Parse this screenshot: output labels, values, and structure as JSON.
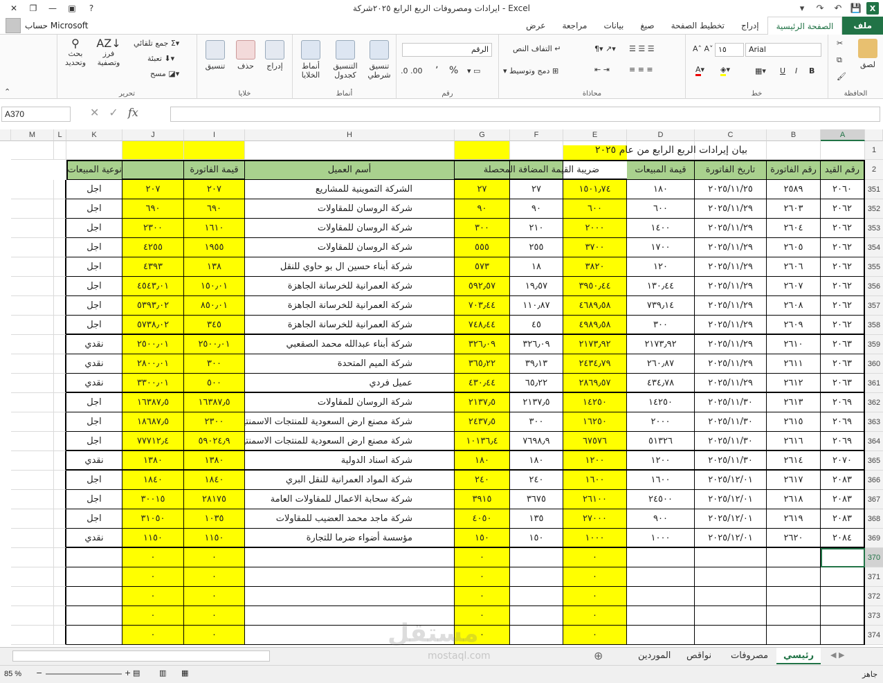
{
  "window": {
    "title": "ايرادات ومصروفات الربع الرابع  ٢٠٢٥شركة - Excel",
    "help": "?",
    "account_name": "حساب Microsoft"
  },
  "ribbon_tabs": [
    "ملف",
    "الصفحة الرئيسية",
    "إدراج",
    "تخطيط الصفحة",
    "صيغ",
    "بيانات",
    "مراجعة",
    "عرض"
  ],
  "ribbon": {
    "clipboard": {
      "label": "الحافظة",
      "paste": "لصق"
    },
    "font": {
      "label": "خط",
      "name": "Arial",
      "size": "١٥",
      "bold": "B",
      "italic": "I",
      "underline": "U"
    },
    "alignment": {
      "label": "محاذاة",
      "wrap": "التفاف النص",
      "merge": "دمج وتوسيط"
    },
    "number": {
      "label": "رقم",
      "format": "الرقم",
      "percent": "%",
      "comma": "٬"
    },
    "styles": {
      "label": "أنماط",
      "conditional": "تنسيق شرطي",
      "table": "التنسيق كجدول",
      "cell": "أنماط الخلايا"
    },
    "cells": {
      "label": "خلايا",
      "insert": "إدراج",
      "delete": "حذف",
      "format": "تنسيق"
    },
    "editing": {
      "label": "تحرير",
      "autosum": "جمع تلقائي",
      "fill": "تعبئة",
      "clear": "مسح",
      "sort": "فرز وتصفية",
      "find": "بحث وتحديد"
    }
  },
  "name_box": "A370",
  "fx": "fx",
  "columns": [
    "A",
    "B",
    "C",
    "D",
    "E",
    "F",
    "G",
    "H",
    "I",
    "J",
    "K",
    "L",
    "M"
  ],
  "title_row": {
    "row": "1",
    "text": "بيان إيرادات الربع الرابع من عام ٢٠٢٥"
  },
  "header_row": {
    "row": "2",
    "cells": [
      "رقم القيد",
      "رقم الفاتورة",
      "تاريخ الفاتورة",
      "قيمة المبيعات",
      "ضريبة القيمة المضافة المحصلة",
      "",
      "",
      "أسم العميل",
      "قيمة الفاتورة",
      "",
      "نوعية المبيعات"
    ]
  },
  "rows": [
    {
      "n": "351",
      "a": "٢٠٦٠",
      "b": "٢٥٨٩",
      "c": "٢٠٢٥/١١/٢٥",
      "d": "١٨٠",
      "e": "١٥٠١٫٧٤",
      "f": "٢٧",
      "g": "٢٧",
      "h": "الشركة التموينية للمشاريع",
      "i": "٢٠٧",
      "j": "٢٠٧",
      "k": "اجل"
    },
    {
      "n": "352",
      "a": "٢٠٦٢",
      "b": "٢٦٠٣",
      "c": "٢٠٢٥/١١/٢٩",
      "d": "٦٠٠",
      "e": "٦٠٠",
      "f": "٩٠",
      "g": "٩٠",
      "h": "شركة الروسان للمقاولات",
      "i": "٦٩٠",
      "j": "٦٩٠",
      "k": "اجل"
    },
    {
      "n": "353",
      "a": "٢٠٦٢",
      "b": "٢٦٠٤",
      "c": "٢٠٢٥/١١/٢٩",
      "d": "١٤٠٠",
      "e": "٢٠٠٠",
      "f": "٢١٠",
      "g": "٣٠٠",
      "h": "شركة الروسان للمقاولات",
      "i": "١٦١٠",
      "j": "٢٣٠٠",
      "k": "اجل"
    },
    {
      "n": "354",
      "a": "٢٠٦٢",
      "b": "٢٦٠٥",
      "c": "٢٠٢٥/١١/٢٩",
      "d": "١٧٠٠",
      "e": "٣٧٠٠",
      "f": "٢٥٥",
      "g": "٥٥٥",
      "h": "شركة الروسان للمقاولات",
      "i": "١٩٥٥",
      "j": "٤٢٥٥",
      "k": "اجل"
    },
    {
      "n": "355",
      "a": "٢٠٦٢",
      "b": "٢٦٠٦",
      "c": "٢٠٢٥/١١/٢٩",
      "d": "١٢٠",
      "e": "٣٨٢٠",
      "f": "١٨",
      "g": "٥٧٣",
      "h": "شركة أبناء حسين ال بو حاوي للنقل",
      "i": "١٣٨",
      "j": "٤٣٩٣",
      "k": "اجل"
    },
    {
      "n": "356",
      "a": "٢٠٦٢",
      "b": "٢٦٠٧",
      "c": "٢٠٢٥/١١/٢٩",
      "d": "١٣٠٫٤٤",
      "e": "٣٩٥٠٫٤٤",
      "f": "١٩٫٥٧",
      "g": "٥٩٢٫٥٧",
      "h": "شركة العمرانية للخرسانة الجاهزة",
      "i": "١٥٠٫٠١",
      "j": "٤٥٤٣٫٠١",
      "k": "اجل"
    },
    {
      "n": "357",
      "a": "٢٠٦٢",
      "b": "٢٦٠٨",
      "c": "٢٠٢٥/١١/٢٩",
      "d": "٧٣٩٫١٤",
      "e": "٤٦٨٩٫٥٨",
      "f": "١١٠٫٨٧",
      "g": "٧٠٣٫٤٤",
      "h": "شركة العمرانية للخرسانة الجاهزة",
      "i": "٨٥٠٫٠١",
      "j": "٥٣٩٣٫٠٢",
      "k": "اجل"
    },
    {
      "n": "358",
      "a": "٢٠٦٢",
      "b": "٢٦٠٩",
      "c": "٢٠٢٥/١١/٢٩",
      "d": "٣٠٠",
      "e": "٤٩٨٩٫٥٨",
      "f": "٤٥",
      "g": "٧٤٨٫٤٤",
      "h": "شركة العمرانية للخرسانة الجاهزة",
      "i": "٣٤٥",
      "j": "٥٧٣٨٫٠٢",
      "k": "اجل"
    },
    {
      "n": "359",
      "a": "٢٠٦٣",
      "b": "٢٦١٠",
      "c": "٢٠٢٥/١١/٢٩",
      "d": "٢١٧٣٫٩٢",
      "e": "٢١٧٣٫٩٢",
      "f": "٣٢٦٫٠٩",
      "g": "٣٢٦٫٠٩",
      "h": "شركة أبناء عبدالله محمد الصقعبي",
      "i": "٢٥٠٠٫٠١",
      "j": "٢٥٠٠٫٠١",
      "k": "نقدي"
    },
    {
      "n": "360",
      "a": "٢٠٦٣",
      "b": "٢٦١١",
      "c": "٢٠٢٥/١١/٢٩",
      "d": "٢٦٠٫٨٧",
      "e": "٢٤٣٤٫٧٩",
      "f": "٣٩٫١٣",
      "g": "٣٦٥٫٢٢",
      "h": "شركة الميم المتحدة",
      "i": "٣٠٠",
      "j": "٢٨٠٠٫٠١",
      "k": "نقدي"
    },
    {
      "n": "361",
      "a": "٢٠٦٣",
      "b": "٢٦١٢",
      "c": "٢٠٢٥/١١/٢٩",
      "d": "٤٣٤٫٧٨",
      "e": "٢٨٦٩٫٥٧",
      "f": "٦٥٫٢٢",
      "g": "٤٣٠٫٤٤",
      "h": "عميل فردي",
      "i": "٥٠٠",
      "j": "٣٣٠٠٫٠١",
      "k": "نقدي"
    },
    {
      "n": "362",
      "a": "٢٠٦٩",
      "b": "٢٦١٣",
      "c": "٢٠٢٥/١١/٣٠",
      "d": "١٤٢٥٠",
      "e": "١٤٢٥٠",
      "f": "٢١٣٧٫٥",
      "g": "٢١٣٧٫٥",
      "h": "شركة الروسان للمقاولات",
      "i": "١٦٣٨٧٫٥",
      "j": "١٦٣٨٧٫٥",
      "k": "اجل"
    },
    {
      "n": "363",
      "a": "٢٠٦٩",
      "b": "٢٦١٥",
      "c": "٢٠٢٥/١١/٣٠",
      "d": "٢٠٠٠",
      "e": "١٦٢٥٠",
      "f": "٣٠٠",
      "g": "٢٤٣٧٫٥",
      "h": "شركة مصنع ارض السعودية للمنتجات الاسمنتية",
      "i": "٢٣٠٠",
      "j": "١٨٦٨٧٫٥",
      "k": "اجل"
    },
    {
      "n": "364",
      "a": "٢٠٦٩",
      "b": "٢٦١٦",
      "c": "٢٠٢٥/١١/٣٠",
      "d": "٥١٣٢٦",
      "e": "٦٧٥٧٦",
      "f": "٧٦٩٨٫٩",
      "g": "١٠١٣٦٫٤",
      "h": "شركة مصنع ارض السعودية للمنتجات الاسمنتية",
      "i": "٥٩٠٢٤٫٩",
      "j": "٧٧٧١٢٫٤",
      "k": "اجل"
    },
    {
      "n": "365",
      "a": "٢٠٧٠",
      "b": "٢٦١٤",
      "c": "٢٠٢٥/١١/٣٠",
      "d": "١٢٠٠",
      "e": "١٢٠٠",
      "f": "١٨٠",
      "g": "١٨٠",
      "h": "شركة اسناد الدولية",
      "i": "١٣٨٠",
      "j": "١٣٨٠",
      "k": "نقدي"
    },
    {
      "n": "366",
      "a": "٢٠٨٣",
      "b": "٢٦١٧",
      "c": "٢٠٢٥/١٢/٠١",
      "d": "١٦٠٠",
      "e": "١٦٠٠",
      "f": "٢٤٠",
      "g": "٢٤٠",
      "h": "شركة المواد العمرانية للنقل البري",
      "i": "١٨٤٠",
      "j": "١٨٤٠",
      "k": "اجل"
    },
    {
      "n": "367",
      "a": "٢٠٨٣",
      "b": "٢٦١٨",
      "c": "٢٠٢٥/١٢/٠١",
      "d": "٢٤٥٠٠",
      "e": "٢٦١٠٠",
      "f": "٣٦٧٥",
      "g": "٣٩١٥",
      "h": "شركة سحابة الاعمال للمقاولات العامة",
      "i": "٢٨١٧٥",
      "j": "٣٠٠١٥",
      "k": "اجل"
    },
    {
      "n": "368",
      "a": "٢٠٨٣",
      "b": "٢٦١٩",
      "c": "٢٠٢٥/١٢/٠١",
      "d": "٩٠٠",
      "e": "٢٧٠٠٠",
      "f": "١٣٥",
      "g": "٤٠٥٠",
      "h": "شركة ماجد محمد العضيب للمقاولات",
      "i": "١٠٣٥",
      "j": "٣١٠٥٠",
      "k": "اجل"
    },
    {
      "n": "369",
      "a": "٢٠٨٤",
      "b": "٢٦٢٠",
      "c": "٢٠٢٥/١٢/٠١",
      "d": "١٠٠٠",
      "e": "١٠٠٠",
      "f": "١٥٠",
      "g": "١٥٠",
      "h": "مؤسسة أضواء ضرما للتجارة",
      "i": "١١٥٠",
      "j": "١١٥٠",
      "k": "نقدي"
    },
    {
      "n": "370",
      "a": "",
      "b": "",
      "c": "",
      "d": "",
      "e": "٠",
      "f": "",
      "g": "٠",
      "h": "",
      "i": "٠",
      "j": "٠",
      "k": ""
    },
    {
      "n": "371",
      "a": "",
      "b": "",
      "c": "",
      "d": "",
      "e": "٠",
      "f": "",
      "g": "٠",
      "h": "",
      "i": "٠",
      "j": "٠",
      "k": ""
    },
    {
      "n": "372",
      "a": "",
      "b": "",
      "c": "",
      "d": "",
      "e": "٠",
      "f": "",
      "g": "٠",
      "h": "",
      "i": "٠",
      "j": "٠",
      "k": ""
    },
    {
      "n": "373",
      "a": "",
      "b": "",
      "c": "",
      "d": "",
      "e": "٠",
      "f": "",
      "g": "٠",
      "h": "",
      "i": "٠",
      "j": "٠",
      "k": ""
    },
    {
      "n": "374",
      "a": "",
      "b": "",
      "c": "",
      "d": "",
      "e": "٠",
      "f": "",
      "g": "٠",
      "h": "",
      "i": "٠",
      "j": "٠",
      "k": ""
    }
  ],
  "sheets": [
    "رئيسي",
    "مصروفات",
    "نواقص",
    "الموردين"
  ],
  "status": {
    "ready": "جاهز",
    "zoom": "85 %"
  },
  "watermark": {
    "ar": "مستقل",
    "en": "mostaql.com"
  }
}
